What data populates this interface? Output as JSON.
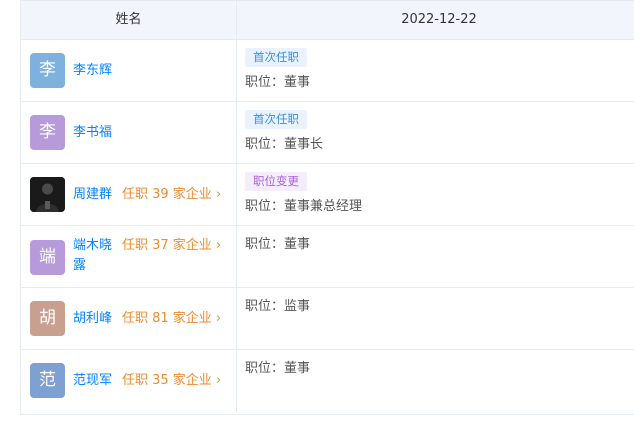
{
  "header": {
    "name_col": "姓名",
    "date_col": "2022-12-22"
  },
  "rows": [
    {
      "avatar": "李",
      "avatar_color": "#7eb1dd",
      "name": "李东辉",
      "tenure": "",
      "tag": "首次任职",
      "tag_style": "blue",
      "position": "职位：董事"
    },
    {
      "avatar": "李",
      "avatar_color": "#b79ad9",
      "name": "李书福",
      "tenure": "",
      "tag": "首次任职",
      "tag_style": "blue",
      "position": "职位：董事长"
    },
    {
      "avatar": "",
      "avatar_color": "#1e1e1e",
      "name": "周建群",
      "tenure": "任职 39 家企业 ›",
      "tag": "职位变更",
      "tag_style": "purple",
      "position": "职位：董事兼总经理"
    },
    {
      "avatar": "端",
      "avatar_color": "#b79ad9",
      "name_line1": "端木晓",
      "name_line2": "露",
      "tenure": "任职 37 家企业 ›",
      "tag": "",
      "position": "职位：董事"
    },
    {
      "avatar": "胡",
      "avatar_color": "#c9a08f",
      "name": "胡利峰",
      "tenure": "任职 81 家企业 ›",
      "tag": "",
      "position": "职位：监事"
    },
    {
      "avatar": "范",
      "avatar_color": "#7fa0d3",
      "name": "范现军",
      "tenure": "任职 35 家企业 ›",
      "tag": "",
      "position": "职位：董事"
    }
  ]
}
